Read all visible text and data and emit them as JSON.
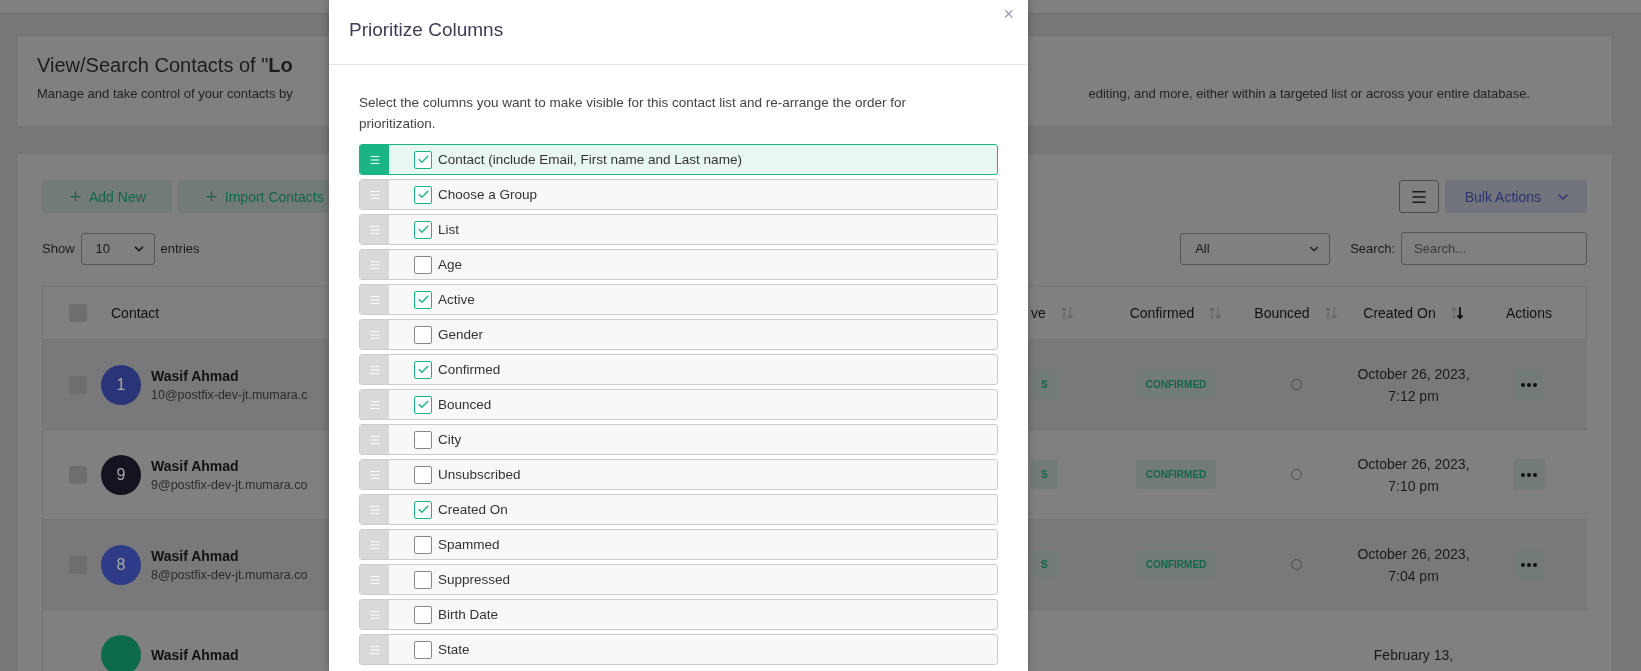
{
  "header_card": {
    "title": "View/Search Contacts of \"**Lo**",
    "description_left": "Manage and take control of your contacts by",
    "description_right": "editing, and more, either within a targeted list or across your entire database."
  },
  "toolbar": {
    "buttons": [
      {
        "label": "Add New",
        "kind": "add"
      },
      {
        "label": "Import Contacts",
        "kind": "add"
      }
    ],
    "bulk_actions": "Bulk Actions"
  },
  "length_menu": {
    "prefix": "Show",
    "value": "10",
    "suffix": "entries"
  },
  "filter": {
    "value": "All"
  },
  "search": {
    "label": "Search:",
    "placeholder": "Search..."
  },
  "table": {
    "select_all_checked": false,
    "left_columns": [
      {
        "label": "Contact"
      }
    ],
    "right_columns": [
      {
        "label": "ve",
        "sorted": false
      },
      {
        "label": "Confirmed",
        "sorted": false
      },
      {
        "label": "Bounced",
        "sorted": false
      },
      {
        "label": "Created On",
        "sorted": true
      },
      {
        "label": "Actions"
      }
    ],
    "rows": [
      {
        "checked": false,
        "avatar": "1",
        "color": "#2a3478",
        "name": "Wasif Ahmad",
        "email": "10@postfix-dev-jt.mumara.c",
        "active": "S",
        "confirmed": "CONFIRMED",
        "bounced": false,
        "created": "October 26, 2023, 7:12 pm"
      },
      {
        "checked": false,
        "avatar": "9",
        "color": "#141420",
        "name": "Wasif Ahmad",
        "email": "9@postfix-dev-jt.mumara.co",
        "active": "S",
        "confirmed": "CONFIRMED",
        "bounced": false,
        "created": "October 26, 2023, 7:10 pm"
      },
      {
        "checked": false,
        "avatar": "8",
        "color": "#2e3b86",
        "name": "Wasif Ahmad",
        "email": "8@postfix-dev-jt.mumara.co",
        "active": "S",
        "confirmed": "CONFIRMED",
        "bounced": false,
        "created": "October 26, 2023, 7:04 pm"
      },
      {
        "color": "#0d6b4b",
        "name": "Wasif Ahmad",
        "created": "February 13,"
      }
    ]
  },
  "modal": {
    "title": "Prioritize Columns",
    "close": "×",
    "intro": "Select the columns you want to make visible for this contact list and re-arrange the order for prioritization.",
    "items": [
      {
        "label": "Contact (include Email, First name and Last name)",
        "checked": true,
        "selected": true
      },
      {
        "label": "Choose a Group",
        "checked": true,
        "selected": false
      },
      {
        "label": "List",
        "checked": true,
        "selected": false
      },
      {
        "label": "Age",
        "checked": false,
        "selected": false
      },
      {
        "label": "Active",
        "checked": true,
        "selected": false
      },
      {
        "label": "Gender",
        "checked": false,
        "selected": false
      },
      {
        "label": "Confirmed",
        "checked": true,
        "selected": false
      },
      {
        "label": "Bounced",
        "checked": true,
        "selected": false
      },
      {
        "label": "City",
        "checked": false,
        "selected": false
      },
      {
        "label": "Unsubscribed",
        "checked": false,
        "selected": false
      },
      {
        "label": "Created On",
        "checked": true,
        "selected": false
      },
      {
        "label": "Spammed",
        "checked": false,
        "selected": false
      },
      {
        "label": "Suppressed",
        "checked": false,
        "selected": false
      },
      {
        "label": "Birth Date",
        "checked": false,
        "selected": false
      },
      {
        "label": "State",
        "checked": false,
        "selected": false
      }
    ]
  }
}
